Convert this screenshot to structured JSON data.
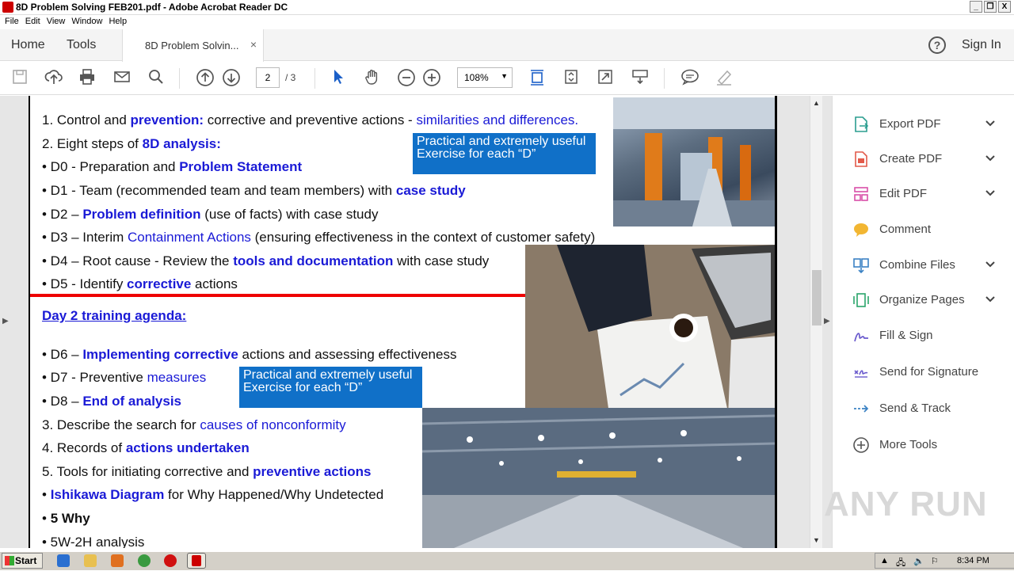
{
  "window": {
    "title": "8D Problem Solving FEB201.pdf - Adobe Acrobat Reader DC",
    "controls": [
      "_",
      "ʃ",
      "X"
    ]
  },
  "menu": [
    "File",
    "Edit",
    "View",
    "Window",
    "Help"
  ],
  "tabs": {
    "home": "Home",
    "tools": "Tools",
    "doc_tab": "8D Problem Solvin...",
    "close": "×",
    "help": "?",
    "sign_in": "Sign In"
  },
  "toolbar": {
    "page_current": "2",
    "page_total": "/ 3",
    "zoom": "108%"
  },
  "document": {
    "lines": {
      "l1a": "1. Control and ",
      "l1b": "prevention:",
      "l1c": " corrective and preventive actions - ",
      "l1d": "similarities and differences.",
      "l2a": "2. Eight steps of ",
      "l2b": "8D analysis:",
      "l3a": "• D0 - Preparation and ",
      "l3b": "Problem Statement",
      "l4a": "• D1 - Team (recommended team and team members) with ",
      "l4b": "case study",
      "l5a": "• D2 – ",
      "l5b": "Problem definition",
      "l5c": " (use of facts) with case study",
      "l6a": "• D3 – Interim ",
      "l6b": "Containment Actions",
      "l6c": " (ensuring effectiveness in the context of customer safety)",
      "l7a": "• D4 – Root cause - Review the ",
      "l7b": "tools and documentation",
      "l7c": " with case study",
      "l8a": "• D5 - Identify ",
      "l8b": "corrective",
      "l8c": " actions",
      "day2": "Day 2 training agenda:",
      "l9a": "• D6 – ",
      "l9b": "Implementing corrective",
      "l9c": " actions and assessing effectiveness",
      "l10a": "• D7 - Preventive ",
      "l10b": "measures",
      "l11a": "• D8 – ",
      "l11b": "End of analysis",
      "l12a": "3. Describe the search for ",
      "l12b": "causes of nonconformity",
      "l13a": "4. Records of ",
      "l13b": "actions undertaken",
      "l14a": "5. Tools for initiating corrective and ",
      "l14b": "preventive actions",
      "l15a": "• ",
      "l15b": "Ishikawa Diagram",
      "l15c": " for Why Happened/Why Undetected",
      "l16a": "• ",
      "l16b": "5 Why",
      "l17": "• 5W-2H analysis"
    },
    "callout1": "Practical and extremely useful Exercise for each “D”",
    "callout2": "Practical and extremely useful Exercise for each “D”"
  },
  "right_pane": [
    {
      "label": "Export PDF",
      "icon": "export-pdf-icon",
      "color": "#2a9d8f",
      "chevron": true
    },
    {
      "label": "Create PDF",
      "icon": "create-pdf-icon",
      "color": "#e25a4a",
      "chevron": true
    },
    {
      "label": "Edit PDF",
      "icon": "edit-pdf-icon",
      "color": "#d94fa8",
      "chevron": true
    },
    {
      "label": "Comment",
      "icon": "comment-icon",
      "color": "#f2b632",
      "chevron": false
    },
    {
      "label": "Combine Files",
      "icon": "combine-files-icon",
      "color": "#3b82c4",
      "chevron": true
    },
    {
      "label": "Organize Pages",
      "icon": "organize-pages-icon",
      "color": "#2aa56a",
      "chevron": true
    },
    {
      "label": "Fill & Sign",
      "icon": "fill-sign-icon",
      "color": "#6a5acd",
      "chevron": false
    },
    {
      "label": "Send for Signature",
      "icon": "send-signature-icon",
      "color": "#6a5acd",
      "chevron": false
    },
    {
      "label": "Send & Track",
      "icon": "send-track-icon",
      "color": "#3b82c4",
      "chevron": false
    },
    {
      "label": "More Tools",
      "icon": "more-tools-icon",
      "color": "#555555",
      "chevron": false
    }
  ],
  "watermark": "ANY RUN",
  "taskbar": {
    "start": "Start",
    "clock": "8:34 PM"
  }
}
